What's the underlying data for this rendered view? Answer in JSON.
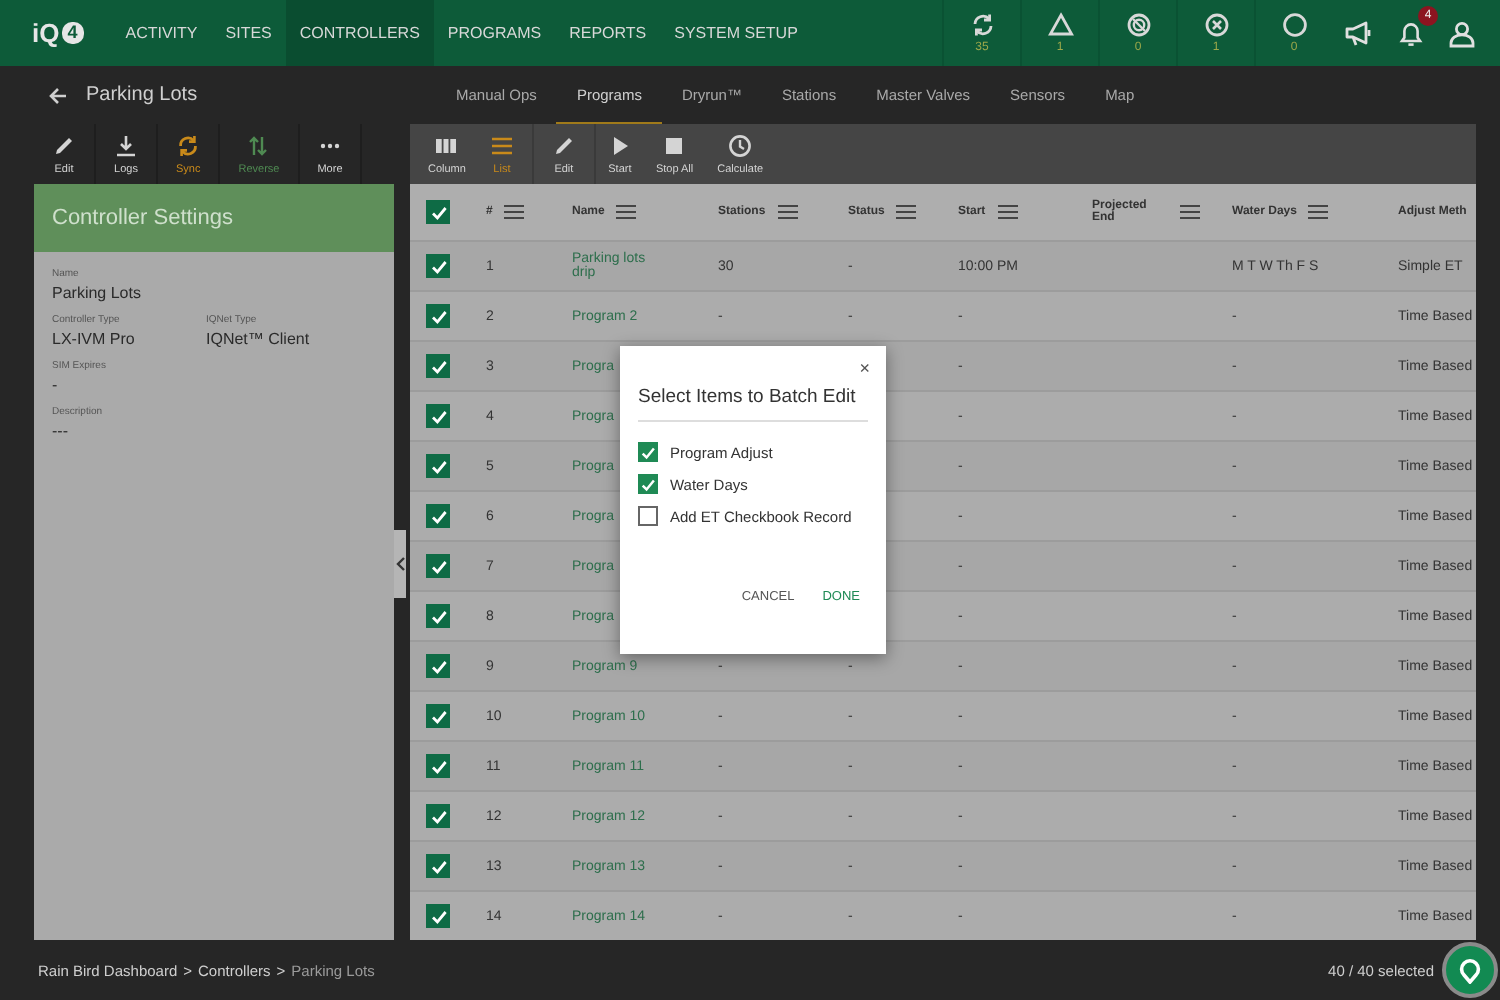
{
  "nav": {
    "logo": "iQ",
    "logo_badge": "4",
    "items": [
      {
        "label": "ACTIVITY",
        "selected": false
      },
      {
        "label": "SITES",
        "selected": false
      },
      {
        "label": "CONTROLLERS",
        "selected": true
      },
      {
        "label": "PROGRAMS",
        "selected": false
      },
      {
        "label": "REPORTS",
        "selected": false
      },
      {
        "label": "SYSTEM SETUP",
        "selected": false
      }
    ]
  },
  "status_counters": [
    {
      "kind": "sync",
      "count": "35"
    },
    {
      "kind": "warning",
      "count": "1"
    },
    {
      "kind": "blocked",
      "count": "0"
    },
    {
      "kind": "error",
      "count": "1"
    },
    {
      "kind": "idle",
      "count": "0"
    }
  ],
  "notifications": {
    "badge": "4"
  },
  "page": {
    "title": "Parking Lots"
  },
  "tabs": [
    {
      "label": "Manual Ops",
      "selected": false
    },
    {
      "label": "Programs",
      "selected": true
    },
    {
      "label": "Dryrun™",
      "selected": false
    },
    {
      "label": "Stations",
      "selected": false
    },
    {
      "label": "Master Valves",
      "selected": false
    },
    {
      "label": "Sensors",
      "selected": false
    },
    {
      "label": "Map",
      "selected": false
    }
  ],
  "controller_toolbar": [
    {
      "kind": "edit",
      "label": "Edit",
      "color": "#d4d4d4"
    },
    {
      "kind": "logs",
      "label": "Logs",
      "color": "#d4d4d4"
    },
    {
      "kind": "sync",
      "label": "Sync",
      "color": "#c98a1a"
    },
    {
      "kind": "reverse",
      "label": "Reverse",
      "color": "#4f8a52"
    },
    {
      "kind": "more",
      "label": "More",
      "color": "#d4d4d4"
    }
  ],
  "controller_settings": {
    "title": "Controller Settings",
    "fields": [
      {
        "kind": "wide",
        "label": "Name",
        "value": "Parking Lots"
      },
      {
        "kind": "narrow",
        "label": "Controller Type",
        "value": "LX-IVM Pro"
      },
      {
        "kind": "narrow",
        "label": "IQNet Type",
        "value": "IQNet™ Client"
      },
      {
        "kind": "wide",
        "label": "SIM Expires",
        "value": "-"
      },
      {
        "kind": "wide",
        "label": "Description",
        "value": "---"
      }
    ]
  },
  "view_toggle": [
    {
      "kind": "column",
      "label": "Column",
      "selected": false
    },
    {
      "kind": "list",
      "label": "List",
      "selected": true
    }
  ],
  "program_actions": [
    {
      "kind": "edit",
      "label": "Edit"
    },
    {
      "kind": "start",
      "label": "Start"
    },
    {
      "kind": "stop",
      "label": "Stop All"
    },
    {
      "kind": "calculate",
      "label": "Calculate"
    }
  ],
  "table": {
    "all_checked": true,
    "columns": [
      {
        "label": "#",
        "menu": true
      },
      {
        "label": "Name",
        "menu": true
      },
      {
        "label": "Stations",
        "menu": true
      },
      {
        "label": "Status",
        "menu": true
      },
      {
        "label": "Start",
        "menu": true
      },
      {
        "label": "Projected End",
        "menu": true
      },
      {
        "label": "Water Days",
        "menu": true
      },
      {
        "label": "Adjust Meth",
        "menu": false
      }
    ],
    "rows": [
      {
        "checked": true,
        "number": "1",
        "name": "Parking lots drip",
        "stations": "30",
        "status": "-",
        "start": "10:00 PM",
        "water_days": "M T W Th F S",
        "adjust_method": "Simple ET"
      },
      {
        "checked": true,
        "number": "2",
        "name": "Program 2",
        "stations": "-",
        "status": "-",
        "start": "-",
        "water_days": "-",
        "adjust_method": "Time Based"
      },
      {
        "checked": true,
        "number": "3",
        "name": "Progra",
        "start": "-",
        "water_days": "-",
        "adjust_method": "Time Based"
      },
      {
        "checked": true,
        "number": "4",
        "name": "Progra",
        "start": "-",
        "water_days": "-",
        "adjust_method": "Time Based"
      },
      {
        "checked": true,
        "number": "5",
        "name": "Progra",
        "start": "-",
        "water_days": "-",
        "adjust_method": "Time Based"
      },
      {
        "checked": true,
        "number": "6",
        "name": "Progra",
        "start": "-",
        "water_days": "-",
        "adjust_method": "Time Based"
      },
      {
        "checked": true,
        "number": "7",
        "name": "Progra",
        "start": "-",
        "water_days": "-",
        "adjust_method": "Time Based"
      },
      {
        "checked": true,
        "number": "8",
        "name": "Progra",
        "start": "-",
        "water_days": "-",
        "adjust_method": "Time Based"
      },
      {
        "checked": true,
        "number": "9",
        "name": "Program 9",
        "stations": "-",
        "status": "-",
        "start": "-",
        "water_days": "-",
        "adjust_method": "Time Based"
      },
      {
        "checked": true,
        "number": "10",
        "name": "Program 10",
        "stations": "-",
        "status": "-",
        "start": "-",
        "water_days": "-",
        "adjust_method": "Time Based"
      },
      {
        "checked": true,
        "number": "11",
        "name": "Program 11",
        "stations": "-",
        "status": "-",
        "start": "-",
        "water_days": "-",
        "adjust_method": "Time Based"
      },
      {
        "checked": true,
        "number": "12",
        "name": "Program 12",
        "stations": "-",
        "status": "-",
        "start": "-",
        "water_days": "-",
        "adjust_method": "Time Based"
      },
      {
        "checked": true,
        "number": "13",
        "name": "Program 13",
        "stations": "-",
        "status": "-",
        "start": "-",
        "water_days": "-",
        "adjust_method": "Time Based"
      },
      {
        "checked": true,
        "number": "14",
        "name": "Program 14",
        "stations": "-",
        "status": "-",
        "start": "-",
        "water_days": "-",
        "adjust_method": "Time Based"
      }
    ]
  },
  "dialog": {
    "close": "×",
    "title": "Select Items to Batch Edit",
    "options": [
      {
        "label": "Program Adjust",
        "checked": true
      },
      {
        "label": "Water Days",
        "checked": true
      },
      {
        "label": "Add ET Checkbook Record",
        "checked": false
      }
    ],
    "buttons": [
      {
        "kind": "secondary",
        "label": "CANCEL"
      },
      {
        "kind": "primary",
        "label": "DONE"
      }
    ]
  },
  "breadcrumb": {
    "separator": ">",
    "items": [
      {
        "label": "Rain Bird Dashboard",
        "current": false
      },
      {
        "label": "Controllers",
        "current": false
      },
      {
        "label": "Parking Lots",
        "current": true
      }
    ]
  },
  "selection_count": "40 / 40 selected"
}
